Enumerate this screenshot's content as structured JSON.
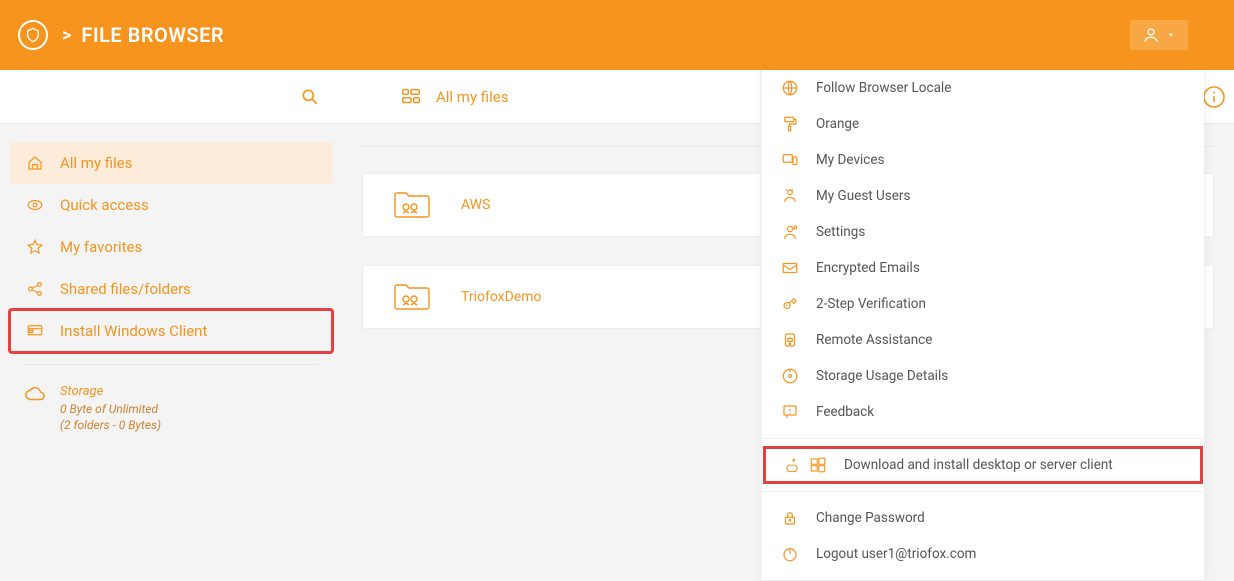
{
  "header": {
    "breadcrumb_sep": ">",
    "title": "FILE BROWSER"
  },
  "toolbar": {
    "crumb": "All my files"
  },
  "sidebar": {
    "items": [
      {
        "label": "All my files",
        "icon": "home-icon",
        "active": true,
        "hl": false
      },
      {
        "label": "Quick access",
        "icon": "eye-icon",
        "active": false,
        "hl": false
      },
      {
        "label": "My favorites",
        "icon": "star-icon",
        "active": false,
        "hl": false
      },
      {
        "label": "Shared files/folders",
        "icon": "share-icon",
        "active": false,
        "hl": false
      },
      {
        "label": "Install Windows Client",
        "icon": "client-icon",
        "active": false,
        "hl": true
      }
    ],
    "storage": {
      "title": "Storage",
      "line1": "0 Byte of Unlimited",
      "line2": "(2 folders - 0 Bytes)"
    }
  },
  "folders": [
    {
      "name": "AWS"
    },
    {
      "name": "TriofoxDemo"
    }
  ],
  "menu": {
    "items": [
      {
        "label": "Follow Browser Locale",
        "icon": "globe-icon"
      },
      {
        "label": "Orange",
        "icon": "paint-icon"
      },
      {
        "label": "My Devices",
        "icon": "devices-icon"
      },
      {
        "label": "My Guest Users",
        "icon": "guest-icon"
      },
      {
        "label": "Settings",
        "icon": "settings-icon"
      },
      {
        "label": "Encrypted Emails",
        "icon": "mail-icon"
      },
      {
        "label": "2-Step Verification",
        "icon": "verify-icon"
      },
      {
        "label": "Remote Assistance",
        "icon": "remote-icon"
      },
      {
        "label": "Storage Usage Details",
        "icon": "disk-icon"
      },
      {
        "label": "Feedback",
        "icon": "feedback-icon"
      }
    ],
    "download": {
      "label": "Download and install desktop or server client",
      "icon1": "apple-icon",
      "icon2": "windows-icon"
    },
    "footer": [
      {
        "label": "Change Password",
        "icon": "lock-icon"
      },
      {
        "label": "Logout user1@triofox.com",
        "icon": "power-icon"
      }
    ]
  },
  "colors": {
    "accent": "#f7941d",
    "highlight": "#e4403f"
  }
}
